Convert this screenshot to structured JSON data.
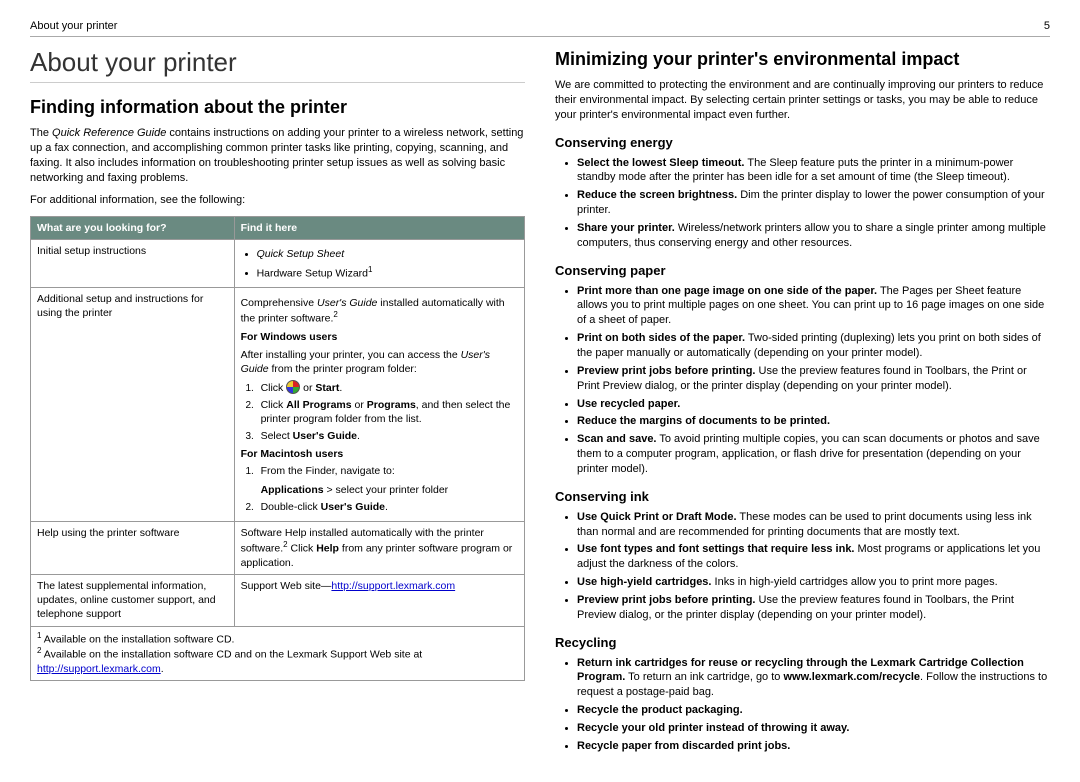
{
  "header": {
    "left": "About your printer",
    "page": "5"
  },
  "left": {
    "h1": "About your printer",
    "h2": "Finding information about the printer",
    "intro_pre": "The ",
    "intro_em": "Quick Reference Guide",
    "intro_post": " contains instructions on adding your printer to a wireless network, setting up a fax connection, and accomplishing common printer tasks like printing, copying, scanning, and faxing. It also includes information on troubleshooting printer setup issues as well as solving basic networking and faxing problems.",
    "see_following": "For additional information, see the following:",
    "th1": "What are you looking for?",
    "th2": "Find it here",
    "row1c1": "Initial setup instructions",
    "row1_b1": "Quick Setup Sheet",
    "row1_b2a": "Hardware Setup Wizard",
    "row1_b2s": "1",
    "row2c1": "Additional setup and instructions for using the printer",
    "row2_p1a": "Comprehensive ",
    "row2_p1em": "User's Guide",
    "row2_p1b": " installed automatically with the printer software.",
    "row2_p1s": "2",
    "row2_win": "For Windows users",
    "row2_win_after": "After installing your printer, you can access the ",
    "row2_win_after_em": "User's Guide",
    "row2_win_after2": " from the printer program folder:",
    "row2_ol1a": "Click ",
    "row2_ol1b": " or ",
    "row2_ol1c": "Start",
    "row2_ol1d": ".",
    "row2_ol2a": "Click ",
    "row2_ol2b": "All Programs",
    "row2_ol2c": " or ",
    "row2_ol2d": "Programs",
    "row2_ol2e": ", and then select the printer program folder from the list.",
    "row2_ol3a": "Select ",
    "row2_ol3b": "User's Guide",
    "row2_ol3c": ".",
    "row2_mac": "For Macintosh users",
    "row2_mac1": "From the Finder, navigate to:",
    "row2_mac_app": "Applications",
    "row2_mac_app2": " > select your printer folder",
    "row2_mac2a": "Double-click ",
    "row2_mac2b": "User's Guide",
    "row2_mac2c": ".",
    "row3c1": "Help using the printer software",
    "row3c2a": "Software Help installed automatically with the printer software.",
    "row3c2s": "2",
    "row3c2b": " Click ",
    "row3c2c": "Help",
    "row3c2d": " from any printer software program or application.",
    "row4c1": "The latest supplemental information, updates, online customer support, and telephone support",
    "row4c2a": "Support Web site—",
    "row4c2link": "http://support.lexmark.com",
    "fn1s": "1",
    "fn1": " Available on the installation software CD.",
    "fn2s": "2",
    "fn2a": " Available on the installation software CD and on the Lexmark Support Web site at ",
    "fn2link": "http://support.lexmark.com",
    "fn2b": "."
  },
  "right": {
    "h2": "Minimizing your printer's environmental impact",
    "intro": "We are committed to protecting the environment and are continually improving our printers to reduce their environmental impact. By selecting certain printer settings or tasks, you may be able to reduce your printer's environmental impact even further.",
    "energy_h": "Conserving energy",
    "e1b": "Select the lowest Sleep timeout.",
    "e1": " The Sleep feature puts the printer in a minimum-power standby mode after the printer has been idle for a set amount of time (the Sleep timeout).",
    "e2b": "Reduce the screen brightness.",
    "e2": " Dim the printer display to lower the power consumption of your printer.",
    "e3b": "Share your printer.",
    "e3": " Wireless/network printers allow you to share a single printer among multiple computers, thus conserving energy and other resources.",
    "paper_h": "Conserving paper",
    "p1b": "Print more than one page image on one side of the paper.",
    "p1": " The Pages per Sheet feature allows you to print multiple pages on one sheet. You can print up to 16 page images on one side of a sheet of paper.",
    "p2b": "Print on both sides of the paper.",
    "p2": " Two-sided printing (duplexing) lets you print on both sides of the paper manually or automatically (depending on your printer model).",
    "p3b": "Preview print jobs before printing.",
    "p3": " Use the preview features found in Toolbars, the Print or Print Preview dialog, or the printer display (depending on your printer model).",
    "p4b": "Use recycled paper.",
    "p5b": "Reduce the margins of documents to be printed.",
    "p6b": "Scan and save.",
    "p6": " To avoid printing multiple copies, you can scan documents or photos and save them to a computer program, application, or flash drive for presentation (depending on your printer model).",
    "ink_h": "Conserving ink",
    "i1b": "Use Quick Print or Draft Mode.",
    "i1": " These modes can be used to print documents using less ink than normal and are recommended for printing documents that are mostly text.",
    "i2b": "Use font types and font settings that require less ink.",
    "i2": " Most programs or applications let you adjust the darkness of the colors.",
    "i3b": "Use high-yield cartridges.",
    "i3": " Inks in high-yield cartridges allow you to print more pages.",
    "i4b": "Preview print jobs before printing.",
    "i4": " Use the preview features found in Toolbars, the Print Preview dialog, or the printer display (depending on your printer model).",
    "rec_h": "Recycling",
    "r1b": "Return ink cartridges for reuse or recycling through the Lexmark Cartridge Collection Program.",
    "r1a": " To return an ink cartridge, go to ",
    "r1link": "www.lexmark.com/recycle",
    "r1c": ". Follow the instructions to request a postage-paid bag.",
    "r2b": "Recycle the product packaging.",
    "r3b": "Recycle your old printer instead of throwing it away.",
    "r4b": "Recycle paper from discarded print jobs."
  }
}
